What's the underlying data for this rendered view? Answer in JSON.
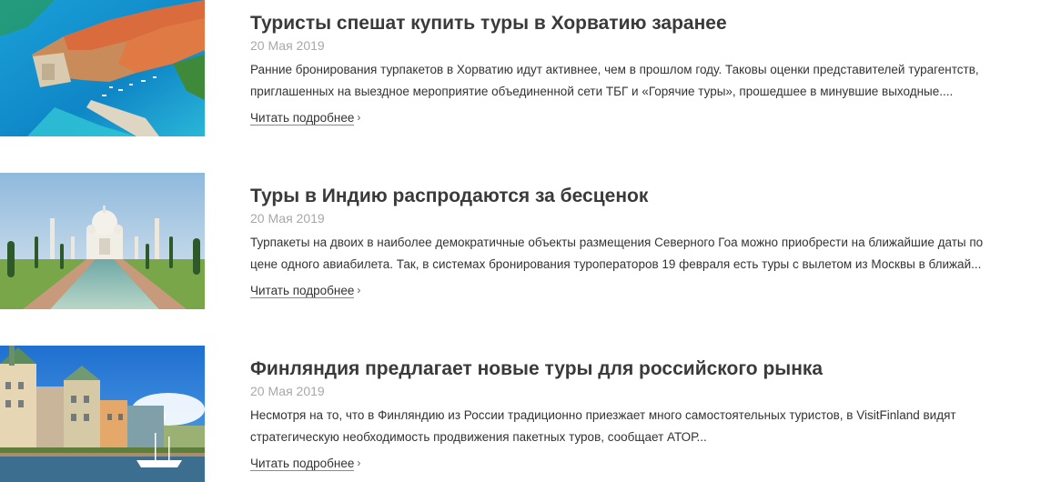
{
  "news": [
    {
      "image_icon": "dubrovnik-photo",
      "title": "Туристы спешат купить туры в Хорватию заранее",
      "date": "20 Мая 2019",
      "excerpt_lines": [
        "Ранние бронирования турпакетов в Хорватию идут активнее, чем в прошлом году. Таковы оценки представителей турагентств,",
        "приглашенных на выездное мероприятие объединенной сети ТБГ и «Горячие туры», прошедшее в минувшие выходные...."
      ],
      "more_label": "Читать подробнее"
    },
    {
      "image_icon": "taj-mahal-photo",
      "title": "Туры в Индию распродаются за бесценок",
      "date": "20 Мая 2019",
      "excerpt_lines": [
        "Турпакеты на двоих в наиболее демократичные объекты размещения Северного Гоа можно приобрести на ближайшие даты по",
        "цене одного авиабилета. Так, в системах бронирования туроператоров 19 февраля есть туры с вылетом из Москвы в ближай..."
      ],
      "more_label": "Читать подробнее"
    },
    {
      "image_icon": "helsinki-photo",
      "title": "Финляндия предлагает новые туры для российского рынка",
      "date": "20 Мая 2019",
      "excerpt_lines": [
        "Несмотря на то, что в Финляндию из России традиционно приезжает много самостоятельных туристов, в VisitFinland видят",
        "стратегическую необходимость продвижения пакетных туров, сообщает АТОР..."
      ],
      "more_label": "Читать подробнее"
    }
  ]
}
